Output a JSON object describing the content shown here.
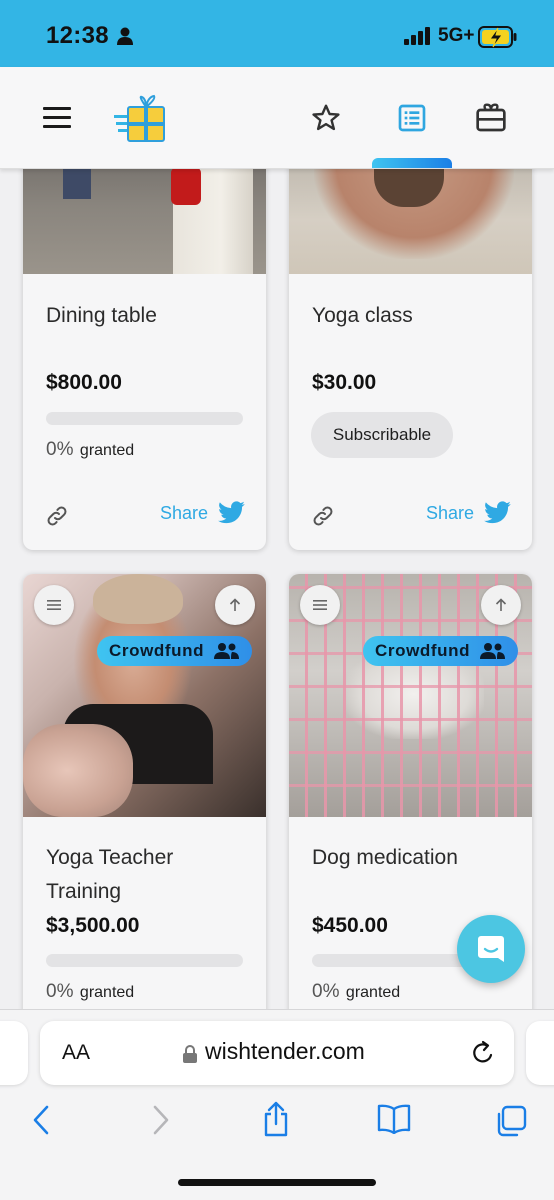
{
  "status_bar": {
    "time": "12:38",
    "network": "5G+",
    "battery": "charging"
  },
  "header": {
    "icons": [
      "menu-icon",
      "wishtender-logo",
      "star-icon",
      "list-icon",
      "gift-card-icon"
    ],
    "active_tab": "list",
    "accent_color": "#33b5e5"
  },
  "cards": [
    {
      "title": "Dining table",
      "price": "$800.00",
      "progress": 0,
      "percent": "0%",
      "granted_label": "granted",
      "share_label": "Share"
    },
    {
      "title": "Yoga class",
      "price": "$30.00",
      "button": "Subscribable",
      "share_label": "Share"
    },
    {
      "title": "Yoga Teacher Training",
      "price": "$3,500.00",
      "badge": "Crowdfund",
      "progress": 0,
      "percent": "0%",
      "granted_label": "granted"
    },
    {
      "title": "Dog medication",
      "price": "$450.00",
      "badge": "Crowdfund",
      "progress": 0,
      "percent": "0%",
      "granted_label": "granted"
    }
  ],
  "browser": {
    "text_size_label": "AA",
    "domain": "wishtender.com",
    "toolbar_icons": [
      "back-icon",
      "forward-icon",
      "share-icon",
      "bookmarks-icon",
      "tabs-icon"
    ]
  }
}
